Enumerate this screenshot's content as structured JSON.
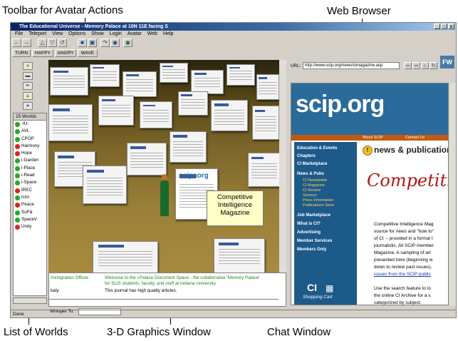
{
  "callouts": {
    "toolbar": "Toolbar for Avatar Actions",
    "browser": "Web Browser",
    "worlds": "List of Worlds",
    "graphics": "3-D Graphics Window",
    "chat": "Chat Window"
  },
  "window": {
    "title": "The Educational Universe - Memory Palace at 10N 11E facing S",
    "controls": [
      "_",
      "□",
      "x"
    ]
  },
  "menu": [
    "File",
    "Teleport",
    "View",
    "Options",
    "Show",
    "Login",
    "Avatar",
    "Web",
    "Help"
  ],
  "gestures": [
    "TURN",
    "HAPPY",
    "ANGRY",
    "WAVE"
  ],
  "worlds": {
    "header": "15 Worlds",
    "items": [
      {
        "name": "-IU-",
        "color": "#22aa22"
      },
      {
        "name": "AVL",
        "color": "#22aa22"
      },
      {
        "name": "CPOP",
        "color": "#22aa22"
      },
      {
        "name": "Harmony",
        "color": "#dd2222"
      },
      {
        "name": "Hope",
        "color": "#dd2222"
      },
      {
        "name": "i-Garden",
        "color": "#22aa22"
      },
      {
        "name": "i-Place",
        "color": "#22aa22"
      },
      {
        "name": "i-Read",
        "color": "#22aa22"
      },
      {
        "name": "i-Space",
        "color": "#22aa22"
      },
      {
        "name": "IREC",
        "color": "#dd2222"
      },
      {
        "name": "iUni",
        "color": "#22aa22"
      },
      {
        "name": "Peace",
        "color": "#dd2222"
      },
      {
        "name": "SoF&",
        "color": "#22aa22"
      },
      {
        "name": "SpaceV",
        "color": "#22aa22"
      },
      {
        "name": "Unity",
        "color": "#dd2222"
      }
    ]
  },
  "scene": {
    "bubble": [
      "Competitive",
      "Intelligence",
      "Magazine"
    ],
    "sign": "scipaorg"
  },
  "chat": {
    "lines": [
      {
        "who": "Immigration Officer:",
        "text": "Welcome to the i-Palace Document Space - the collaborative 'Memory Palace'",
        "color": "#1a8a1a"
      },
      {
        "who": "",
        "text": "for SLIS students, faculty, and staff at Indiana University",
        "color": "#1a8a1a"
      },
      {
        "who": "katy:",
        "text": "This journal has high quality articles.",
        "color": "#000000"
      }
    ],
    "whisper_label": "Whisper To"
  },
  "browser": {
    "url_label": "URL:",
    "url": "http://www.scip.org/news/cimagazine.asp",
    "logo": "scip.org",
    "topnav": [
      "About SCIP",
      "Contact Us"
    ],
    "nav": [
      {
        "head": "Education & Events"
      },
      {
        "head": "Chapters"
      },
      {
        "head": "CI Marketplace"
      },
      {
        "head": "News & Pubs",
        "subs": [
          "CI Newsbriefs",
          "CI Magazine",
          "CI Review",
          "Surveys",
          "Press Information",
          "Publications Store"
        ]
      },
      {
        "head": "Job Marketplace"
      },
      {
        "head": "What is CI?"
      },
      {
        "head": "Advertising"
      },
      {
        "head": "Member Services"
      },
      {
        "head": "Members Only"
      }
    ],
    "heading": "news & publications",
    "script_title": "Competitive",
    "body_lines": [
      "Competitive Intelligence Mag",
      "source for news and \"how to\"",
      "of CI -- provided in a format t",
      "journalistic. All SCIP member",
      "Magazine. A sampling of art",
      "presented here (beginning w",
      "down to review past issues).",
      "issues from the SCIP public"
    ],
    "search_lines": [
      "Use the search feature to lo",
      "the online CI Archive for a s",
      "categorized by subject."
    ],
    "cart": [
      "CI",
      "Shopping Cart"
    ]
  },
  "status": "Done"
}
